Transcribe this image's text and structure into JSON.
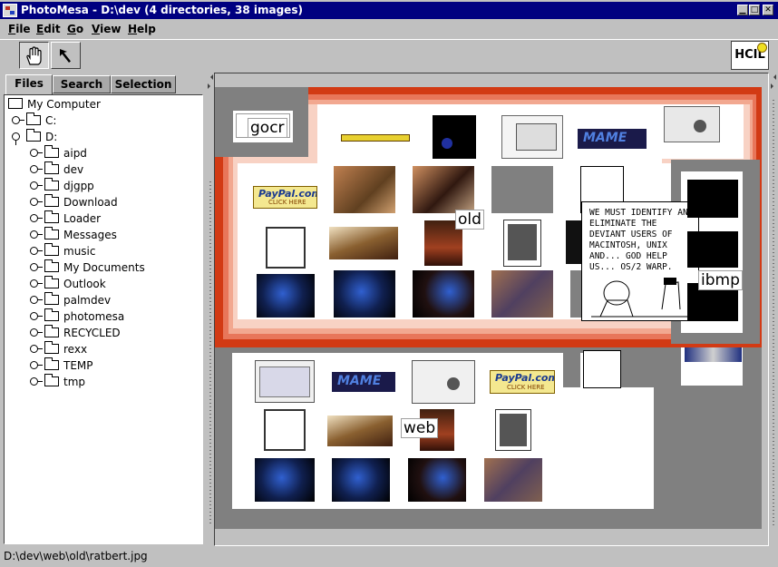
{
  "window": {
    "title": "PhotoMesa - D:\\dev (4 directories, 38 images)"
  },
  "menu": [
    {
      "label": "File",
      "underline": "F",
      "rest": "ile"
    },
    {
      "label": "Edit",
      "underline": "E",
      "rest": "dit"
    },
    {
      "label": "Go",
      "underline": "G",
      "rest": "o"
    },
    {
      "label": "View",
      "underline": "V",
      "rest": "iew"
    },
    {
      "label": "Help",
      "underline": "H",
      "rest": "elp"
    }
  ],
  "toolbar": {
    "pan_tool": "hand-icon",
    "select_tool": "arrow-pointer-icon",
    "logo": "HCIL"
  },
  "tabs": [
    "Files",
    "Search",
    "Selection"
  ],
  "tree": {
    "root": "My Computer",
    "drives": [
      "C:",
      "D:"
    ],
    "folders": [
      "aipd",
      "dev",
      "djgpp",
      "Download",
      "Loader",
      "Messages",
      "music",
      "My Documents",
      "Outlook",
      "palmdev",
      "photomesa",
      "RECYCLED",
      "rexx",
      "TEMP",
      "tmp"
    ]
  },
  "groups": {
    "gocr": "gocr",
    "old": "old",
    "ibmp": "ibmp",
    "web": "web"
  },
  "comic_text": "We must identify and eliminate the deviant users of Macintosh, Unix and... God help us... OS/2 Warp.",
  "thumb_labels": {
    "paypal": "PayPal.com",
    "paypal_sub": "CLICK HERE",
    "mame": "MAME"
  },
  "status": "D:\\dev\\web\\old\\ratbert.jpg",
  "colors": {
    "titlebar": "#000080",
    "highlight": "#d23a14",
    "group_bg": "#808080",
    "panel": "#c0c0c0"
  }
}
